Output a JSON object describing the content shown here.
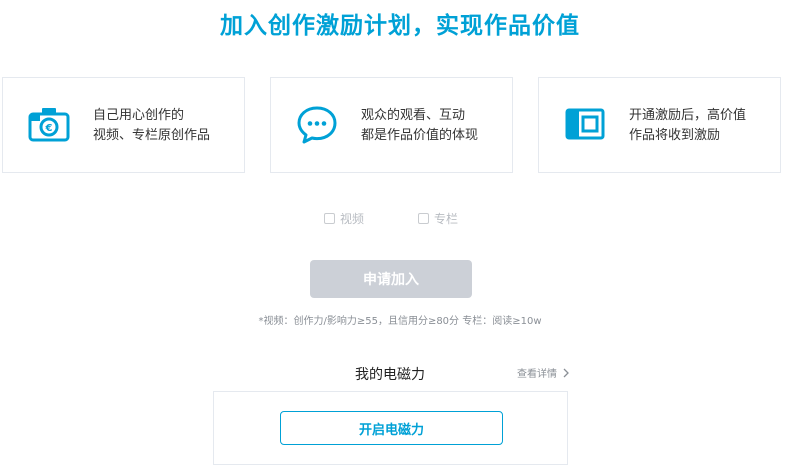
{
  "headline": "加入创作激励计划，实现作品价值",
  "cards": [
    {
      "line1": "自己用心创作的",
      "line2": "视频、专栏原创作品"
    },
    {
      "line1": "观众的观看、互动",
      "line2": "都是作品价值的体现"
    },
    {
      "line1": "开通激励后，高价值",
      "line2": "作品将收到激励"
    }
  ],
  "checkboxes": [
    {
      "label": "视频",
      "checked": false
    },
    {
      "label": "专栏",
      "checked": false
    }
  ],
  "apply_button": "申请加入",
  "requirements": "*视频：创作力/影响力≥55，且信用分≥80分 专栏：阅读≥10w",
  "electromagnetic": {
    "title": "我的电磁力",
    "detail_link": "查看详情",
    "open_button": "开启电磁力"
  },
  "colors": {
    "accent": "#00a1d6",
    "disabled_button": "#ccd0d7",
    "border": "#e5e9ef"
  },
  "icons": {
    "card_1": "camera-icon",
    "card_2": "chat-bubble-icon",
    "card_3": "wallet-icon",
    "detail": "chevron-right-icon"
  }
}
